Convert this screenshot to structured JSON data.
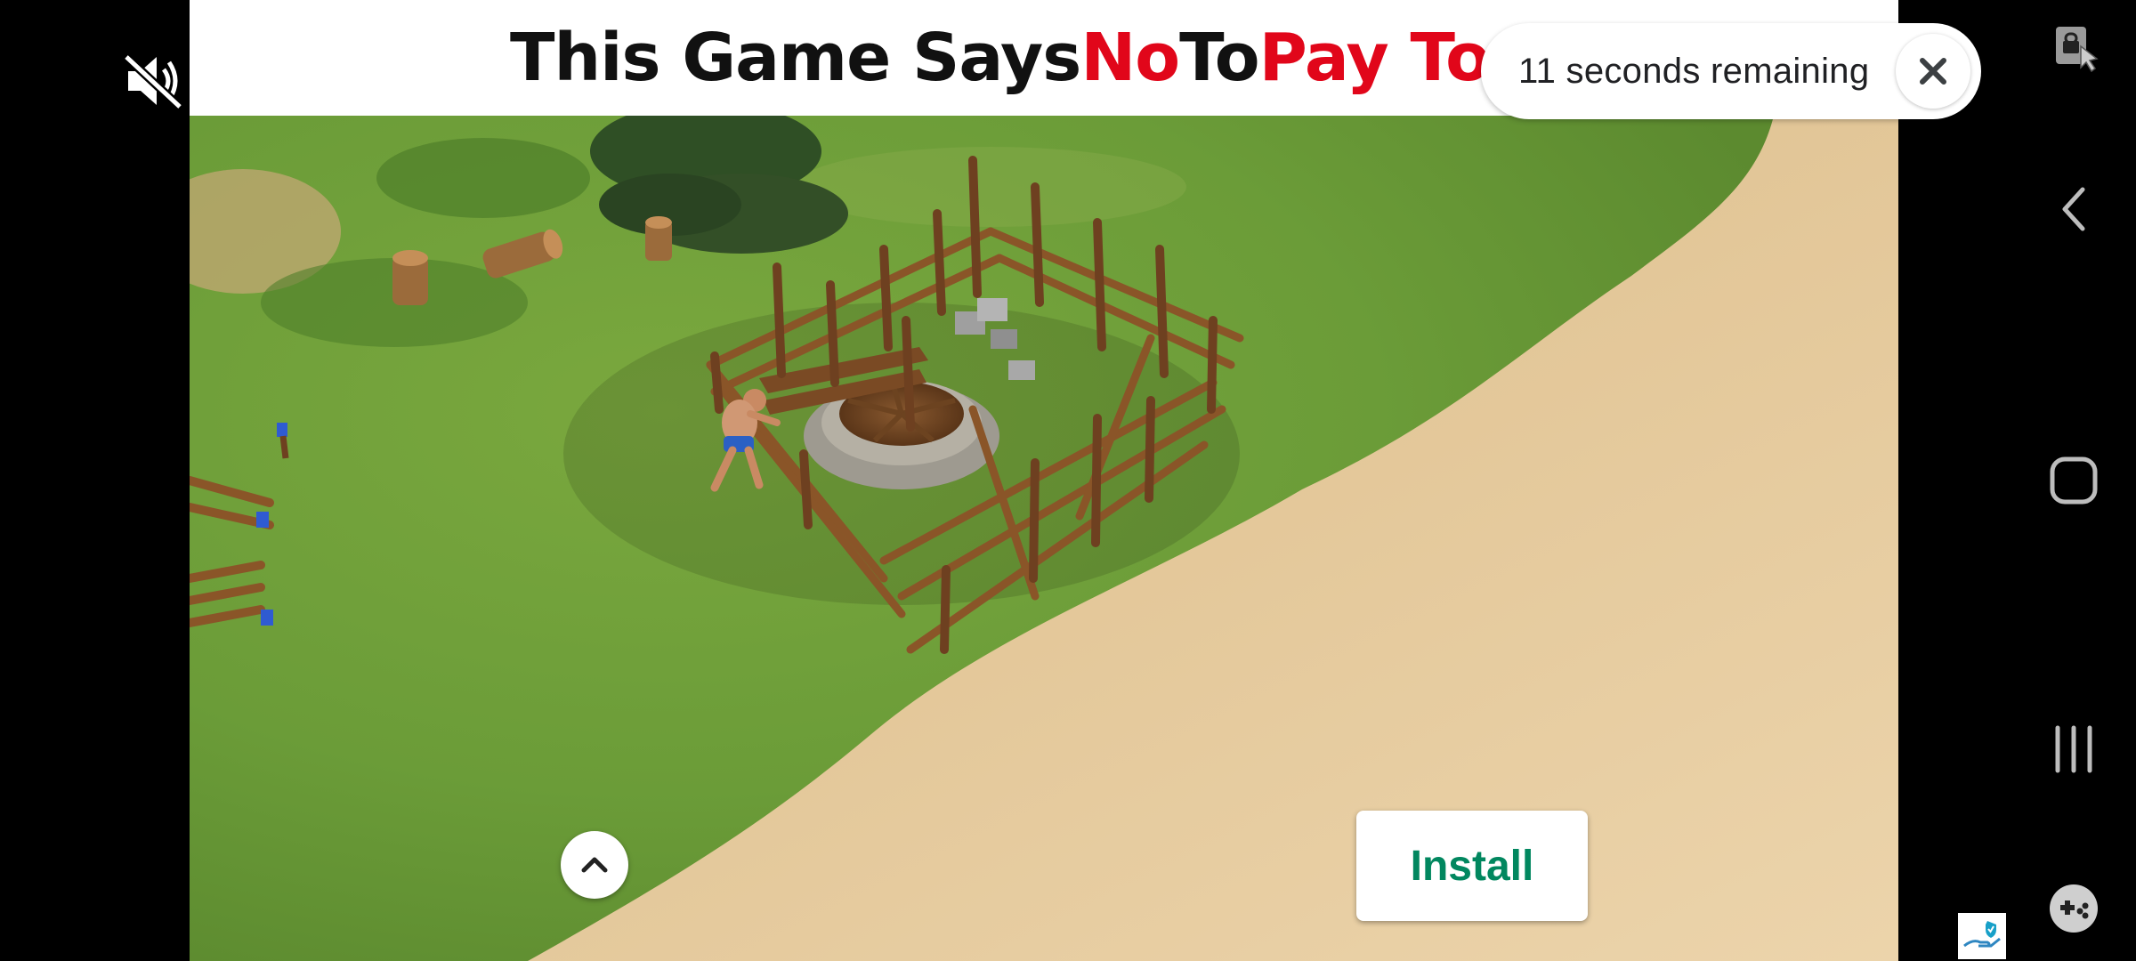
{
  "ad": {
    "banner": {
      "part1": "This Game Says ",
      "part2": "No",
      "part3": " To ",
      "part4": "Pay To W",
      "accent_color": "#e1061a"
    },
    "timer_text": "11 seconds remaining",
    "install_label": "Install",
    "install_color": "#01875f"
  },
  "icons": {
    "mute": "volume-muted-icon",
    "close": "close-icon",
    "chevron_up": "chevron-up-icon",
    "screen_lock": "screen-lock-icon",
    "back": "back-icon",
    "home": "home-icon",
    "recents": "recents-icon",
    "game": "game-controller-icon",
    "badge": "safe-hand-icon"
  }
}
